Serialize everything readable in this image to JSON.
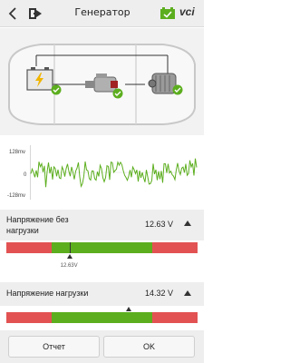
{
  "header": {
    "title": "Генератор",
    "vci_label": "vci"
  },
  "oscilloscope": {
    "top_label": "128mv",
    "mid_label": "0",
    "bottom_label": "-128mv",
    "signal_color": "#5cae1e"
  },
  "measurements": [
    {
      "label_line1": "Напряжение без",
      "label_line2": "нагрузки",
      "value": "12.63 V",
      "marker_label": "12.63V",
      "marker_fraction": 0.33
    },
    {
      "label_line1": "Напряжение нагрузки",
      "label_line2": "",
      "value": "14.32 V",
      "marker_label": "",
      "marker_fraction": 0.64
    }
  ],
  "footer": {
    "report_label": "Отчет",
    "ok_label": "OK"
  },
  "colors": {
    "gauge_red": "#e25252",
    "gauge_green": "#5cae1e",
    "status_ok": "#5cae1e"
  }
}
